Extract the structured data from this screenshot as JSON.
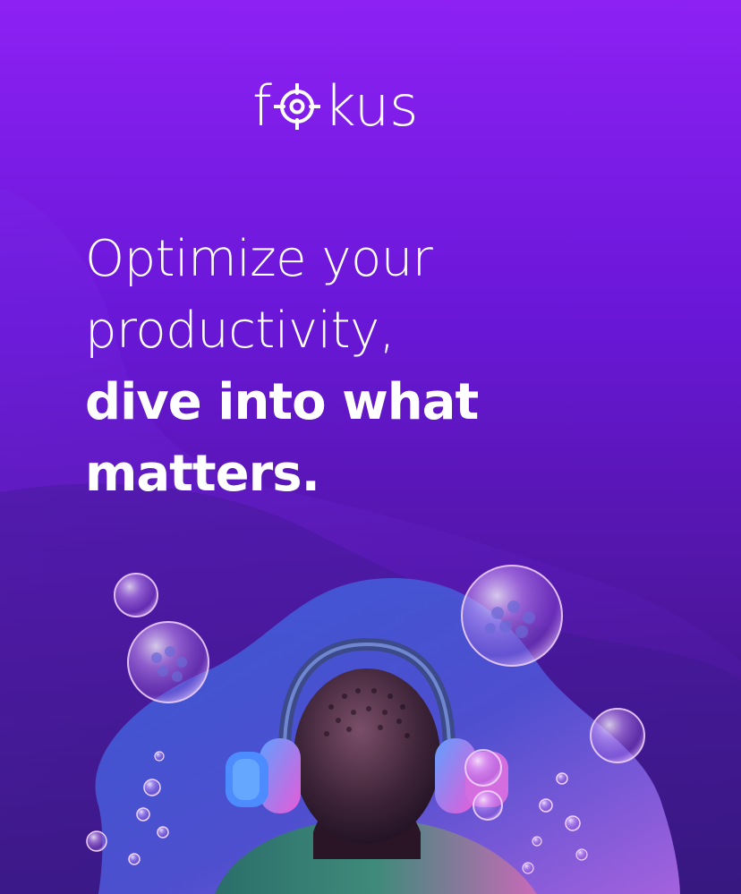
{
  "brand": {
    "name_prefix": "f",
    "name_suffix": "kus",
    "logo_icon": "target-crosshair-icon",
    "color": "#ffffff"
  },
  "headline": {
    "line1": "Optimize your",
    "line2": "productivity,",
    "line3": "dive into what",
    "line4": "matters."
  },
  "theme": {
    "bg_top": "#8d21f4",
    "bg_bottom": "#311772",
    "text": "#ffffff",
    "accent_pink": "#e77bf3",
    "accent_blue": "#3d7ef0"
  },
  "illustration": {
    "subject": "person-with-headphones-illustration",
    "decor": "bubbles-decoration"
  }
}
